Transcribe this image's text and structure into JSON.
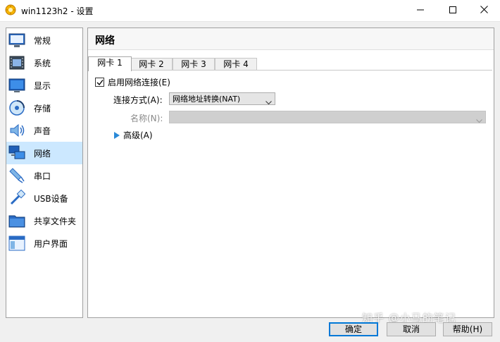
{
  "window": {
    "title": "win1123h2 - 设置",
    "controls": {
      "minimize": "minimize-icon",
      "maximize": "maximize-icon",
      "close": "close-icon"
    }
  },
  "sidebar": {
    "items": [
      {
        "label": "常规",
        "icon": "general-icon"
      },
      {
        "label": "系统",
        "icon": "system-icon"
      },
      {
        "label": "显示",
        "icon": "display-icon"
      },
      {
        "label": "存储",
        "icon": "storage-icon"
      },
      {
        "label": "声音",
        "icon": "audio-icon"
      },
      {
        "label": "网络",
        "icon": "network-icon",
        "selected": true
      },
      {
        "label": "串口",
        "icon": "serial-port-icon"
      },
      {
        "label": "USB设备",
        "icon": "usb-icon"
      },
      {
        "label": "共享文件夹",
        "icon": "shared-folder-icon"
      },
      {
        "label": "用户界面",
        "icon": "user-interface-icon"
      }
    ]
  },
  "main": {
    "title": "网络",
    "tabs": [
      {
        "label": "网卡 1",
        "active": true
      },
      {
        "label": "网卡 2"
      },
      {
        "label": "网卡 3"
      },
      {
        "label": "网卡 4"
      }
    ],
    "adapter": {
      "enable_label": "启用网络连接(E)",
      "enabled": true,
      "attached_label": "连接方式(A):",
      "attached_value": "网络地址转换(NAT)",
      "name_label": "名称(N):",
      "name_value": "",
      "advanced_label": "高级(A)"
    }
  },
  "buttons": {
    "ok": "确定",
    "cancel": "取消",
    "help": "帮助(H)"
  },
  "watermark": "知乎 @小马的笔记",
  "colors": {
    "selection": "#cce8ff",
    "accent": "#0078d7",
    "border": "#a0a0a0"
  }
}
